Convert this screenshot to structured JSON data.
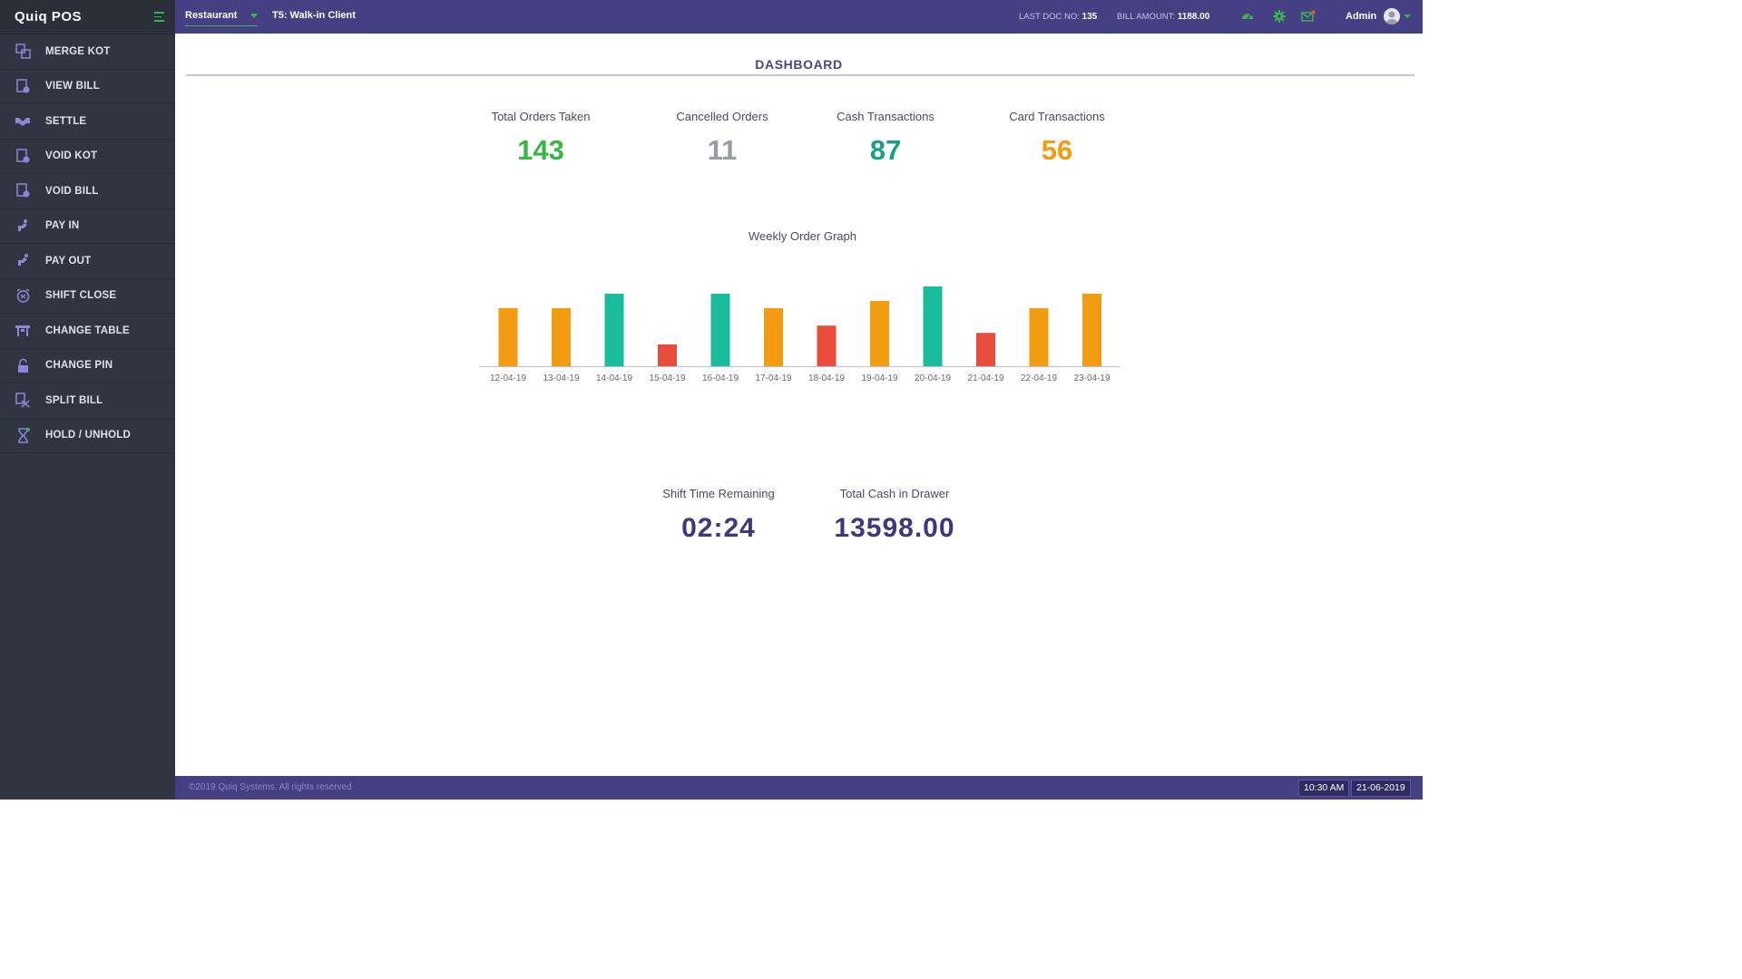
{
  "app": {
    "title": "Quiq POS"
  },
  "sidebar": {
    "items": [
      {
        "label": "MERGE KOT",
        "icon": "merge-kot-icon"
      },
      {
        "label": "VIEW BILL",
        "icon": "view-bill-icon"
      },
      {
        "label": "SETTLE",
        "icon": "handshake-icon"
      },
      {
        "label": "VOID KOT",
        "icon": "void-kot-icon"
      },
      {
        "label": "VOID BILL",
        "icon": "void-bill-icon"
      },
      {
        "label": "PAY IN",
        "icon": "pay-in-icon"
      },
      {
        "label": "PAY OUT",
        "icon": "pay-out-icon"
      },
      {
        "label": "SHIFT CLOSE",
        "icon": "alarm-clock-icon"
      },
      {
        "label": "CHANGE TABLE",
        "icon": "table-icon"
      },
      {
        "label": "CHANGE PIN",
        "icon": "unlock-icon"
      },
      {
        "label": "SPLIT BILL",
        "icon": "split-bill-icon"
      },
      {
        "label": "HOLD / UNHOLD",
        "icon": "hourglass-icon"
      }
    ]
  },
  "topbar": {
    "mode_select": "Restaurant",
    "table": "T5: Walk-in Client",
    "last_doc_label": "LAST DOC NO:",
    "last_doc_value": "135",
    "bill_amount_label": "BILL AMOUNT:",
    "bill_amount_value": "1188.00",
    "user": "Admin",
    "icons": [
      "dashboard-gauge-icon",
      "gear-icon",
      "mail-icon"
    ]
  },
  "dashboard": {
    "title": "DASHBOARD",
    "stats": [
      {
        "label": "Total Orders Taken",
        "value": "143",
        "color": "#39b54a"
      },
      {
        "label": "Cancelled Orders",
        "value": "11",
        "color": "#959ea6"
      },
      {
        "label": "Cash Transactions",
        "value": "87",
        "color": "#17a085"
      },
      {
        "label": "Card Transactions",
        "value": "56",
        "color": "#f39c12"
      }
    ],
    "chart_title": "Weekly Order Graph",
    "shift_label": "Shift Time Remaining",
    "shift_value": "02:24",
    "cash_label": "Total Cash in Drawer",
    "cash_value": "13598.00"
  },
  "chart_data": {
    "type": "bar",
    "title": "Weekly Order Graph",
    "categories": [
      "12-04-19",
      "13-04-19",
      "14-04-19",
      "15-04-19",
      "16-04-19",
      "17-04-19",
      "18-04-19",
      "19-04-19",
      "20-04-19",
      "21-04-19",
      "22-04-19",
      "23-04-19"
    ],
    "values": [
      8,
      8,
      10,
      3,
      10,
      8,
      5.6,
      9,
      11,
      4.6,
      8,
      10
    ],
    "colors": [
      "#f39c12",
      "#f39c12",
      "#1abc9c",
      "#e74c3c",
      "#1abc9c",
      "#f39c12",
      "#e74c3c",
      "#f39c12",
      "#1abc9c",
      "#e74c3c",
      "#f39c12",
      "#f39c12"
    ],
    "ylim": [
      0,
      11
    ],
    "grid": false
  },
  "footer": {
    "copyright": "©2019 Quiq Systems. All rights reserved",
    "time": "10:30 AM",
    "date": "21-06-2019"
  }
}
